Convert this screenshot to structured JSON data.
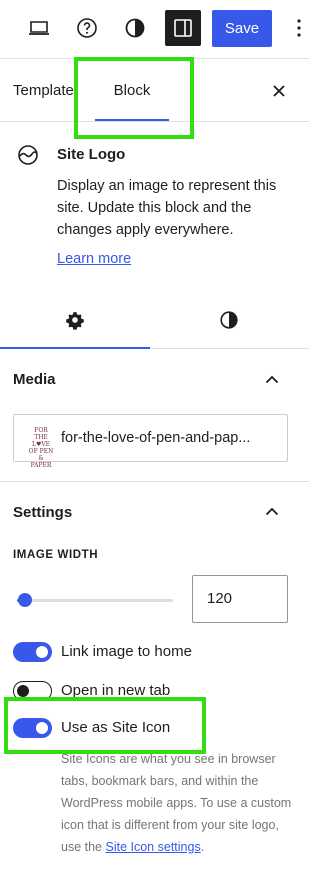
{
  "toolbar": {
    "icons": [
      "desktop-preview-icon",
      "help-icon",
      "styles-contrast-icon",
      "sidebar-toggle-icon",
      "more-options-icon"
    ],
    "save_label": "Save"
  },
  "tabs": {
    "template_label": "Template",
    "block_label": "Block",
    "active": "Block"
  },
  "block": {
    "title": "Site Logo",
    "description": "Display an image to represent this site. Update this block and the changes apply everywhere.",
    "learn_more": "Learn more"
  },
  "sub_tabs": {
    "active": "settings",
    "icons": [
      "settings-gear-icon",
      "styles-contrast-icon"
    ]
  },
  "media": {
    "title": "Media",
    "filename": "for-the-love-of-pen-and-pap...",
    "thumb_text": "FOR THE L♥VE OF PEN & PAPER"
  },
  "settings": {
    "title": "Settings",
    "image_width_label": "IMAGE WIDTH",
    "image_width_value": "120",
    "slider_fraction": 0.04,
    "link_home_label": "Link image to home",
    "link_home_on": true,
    "new_tab_label": "Open in new tab",
    "new_tab_on": false,
    "site_icon_label": "Use as Site Icon",
    "site_icon_on": true,
    "help_text": "Site Icons are what you see in browser tabs, bookmark bars, and within the WordPress mobile apps. To use a custom icon that is different from your site logo, use the",
    "help_link": "Site Icon settings",
    "help_end": "."
  },
  "colors": {
    "accent": "#3858e9",
    "highlight": "#33dd11",
    "text": "#1e1e1e",
    "muted": "#757575"
  }
}
